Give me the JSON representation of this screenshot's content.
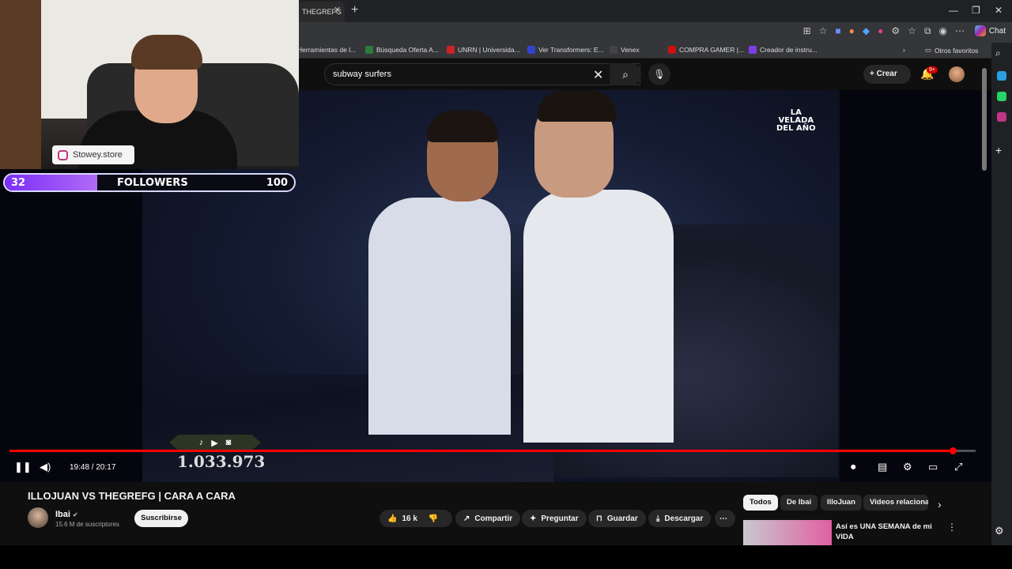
{
  "browser": {
    "tab_title": "THEGREFG",
    "bookmarks": [
      {
        "label": "Herramientas de l...",
        "color": "#888"
      },
      {
        "label": "Búsqueda Oferta A...",
        "color": "#2a7d3a"
      },
      {
        "label": "UNRN | Universida...",
        "color": "#cc2222"
      },
      {
        "label": "Ver Transformers: E...",
        "color": "#3344cc"
      },
      {
        "label": "Venex",
        "color": "#444"
      },
      {
        "label": "COMPRA GAMER |...",
        "color": "#cc1111"
      },
      {
        "label": "Creador de instru...",
        "color": "#7b3fe4"
      }
    ],
    "other_favorites": "Otros favoritos",
    "chat_label": "Chat"
  },
  "youtube": {
    "search_query": "subway surfers",
    "create_label": "Crear",
    "notifications_badge": "9+"
  },
  "overlay": {
    "instagram_handle": "Stowey.store",
    "followers_current": "32",
    "followers_label": "FOLLOWERS",
    "followers_goal": "100",
    "followers_progress": 0.32,
    "social_counter": "1.033.973",
    "event_logo": "LA VELADA DEL AÑO"
  },
  "player": {
    "time": "19:48 / 20:17",
    "progress": 0.976
  },
  "video": {
    "title": "ILLOJUAN VS THEGREFG | CARA A CARA",
    "channel": "Ibai",
    "subscribers": "15.6 M de suscriptores",
    "subscribe_label": "Suscribirse",
    "likes": "16 k",
    "share_label": "Compartir",
    "ask_label": "Preguntar",
    "save_label": "Guardar",
    "download_label": "Descargar"
  },
  "chips": [
    "Todos",
    "De Ibai",
    "IlloJuan",
    "Videos relacionad"
  ],
  "recommendation": {
    "title": "Así es UNA SEMANA de mi VIDA"
  }
}
